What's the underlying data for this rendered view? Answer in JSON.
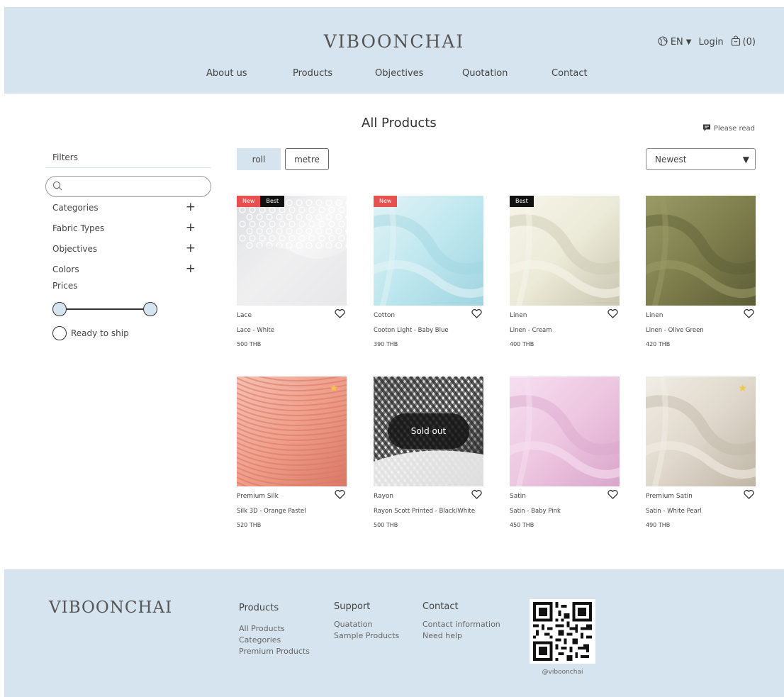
{
  "header": {
    "logo": "VIBOONCHAI",
    "lang": "EN",
    "login": "Login",
    "cart_count": "(0)",
    "nav": [
      "About us",
      "Products",
      "Objectives",
      "Quotation",
      "Contact"
    ]
  },
  "page": {
    "title": "All Products",
    "please_read": "Please read"
  },
  "sidebar": {
    "filters_title": "Filters",
    "search_placeholder": "",
    "items": [
      "Categories",
      "Fabric Types",
      "Objectives",
      "Colors"
    ],
    "prices_label": "Prices",
    "ready_to_ship": "Ready to ship"
  },
  "toolbar": {
    "roll": "roll",
    "metre": "metre",
    "sort": "Newest"
  },
  "products": [
    {
      "category": "Lace",
      "name": "Lace - White",
      "price": "500 THB",
      "new": true,
      "best": true,
      "premium": false,
      "sold_out": false,
      "colors": [
        "#f7f7f7",
        "#e7e7e9",
        "#d9dadd"
      ],
      "fabric": "lace"
    },
    {
      "category": "Cotton",
      "name": "Cooton Light -  Baby Blue",
      "price": "390 THB",
      "new": true,
      "best": false,
      "premium": false,
      "sold_out": false,
      "colors": [
        "#bfe7ee",
        "#9fd4e0",
        "#e2f3f6"
      ],
      "fabric": "fold"
    },
    {
      "category": "Linen",
      "name": "Linen - Cream",
      "price": "400 THB",
      "new": false,
      "best": true,
      "premium": false,
      "sold_out": false,
      "colors": [
        "#ecead8",
        "#c9c7b1",
        "#f6f5ea"
      ],
      "fabric": "fold"
    },
    {
      "category": "Linen",
      "name": "Linen - Olive Green",
      "price": "420 THB",
      "new": false,
      "best": false,
      "premium": false,
      "sold_out": false,
      "colors": [
        "#7f7f4e",
        "#5c5d36",
        "#9a9a66"
      ],
      "fabric": "fold"
    },
    {
      "category": "Premium Silk",
      "name": "Silk 3D - Orange Pastel",
      "price": "520 THB",
      "new": false,
      "best": false,
      "premium": true,
      "sold_out": false,
      "colors": [
        "#ef9e8a",
        "#d97866",
        "#f6c0b2"
      ],
      "fabric": "pleat"
    },
    {
      "category": "Rayon",
      "name": "Rayon Scott Printed - Black/White",
      "price": "500 THB",
      "new": false,
      "best": false,
      "premium": false,
      "sold_out": true,
      "colors": [
        "#f3f3f3",
        "#2a2a2a",
        "#bdbdbd"
      ],
      "fabric": "gingham"
    },
    {
      "category": "Satin",
      "name": "Satin - Baby Pink",
      "price": "450 THB",
      "new": false,
      "best": false,
      "premium": false,
      "sold_out": false,
      "colors": [
        "#edc6e0",
        "#d9a6cb",
        "#f6dff0"
      ],
      "fabric": "fold"
    },
    {
      "category": "Premium Satin",
      "name": "Satin - White Pearl",
      "price": "490 THB",
      "new": false,
      "best": false,
      "premium": true,
      "sold_out": false,
      "colors": [
        "#dfd8cc",
        "#bfb6a6",
        "#f1ede5"
      ],
      "fabric": "fold"
    }
  ],
  "labels": {
    "new": "New",
    "best": "Best",
    "sold_out": "Sold out"
  },
  "footer": {
    "logo": "VIBOONCHAI",
    "columns": [
      {
        "title": "Products",
        "links": [
          "All Products",
          "Categories",
          "Premium Products"
        ]
      },
      {
        "title": "Support",
        "links": [
          "Quatation",
          "Sample Products"
        ]
      },
      {
        "title": "Contact",
        "links": [
          "Contact information",
          "Need help"
        ]
      }
    ],
    "qr_label": "@viboonchai"
  },
  "colors": {
    "header_bg": "#d5e4ef",
    "badge_new": "#e85050",
    "badge_best": "#111111",
    "star": "#f3c640"
  }
}
